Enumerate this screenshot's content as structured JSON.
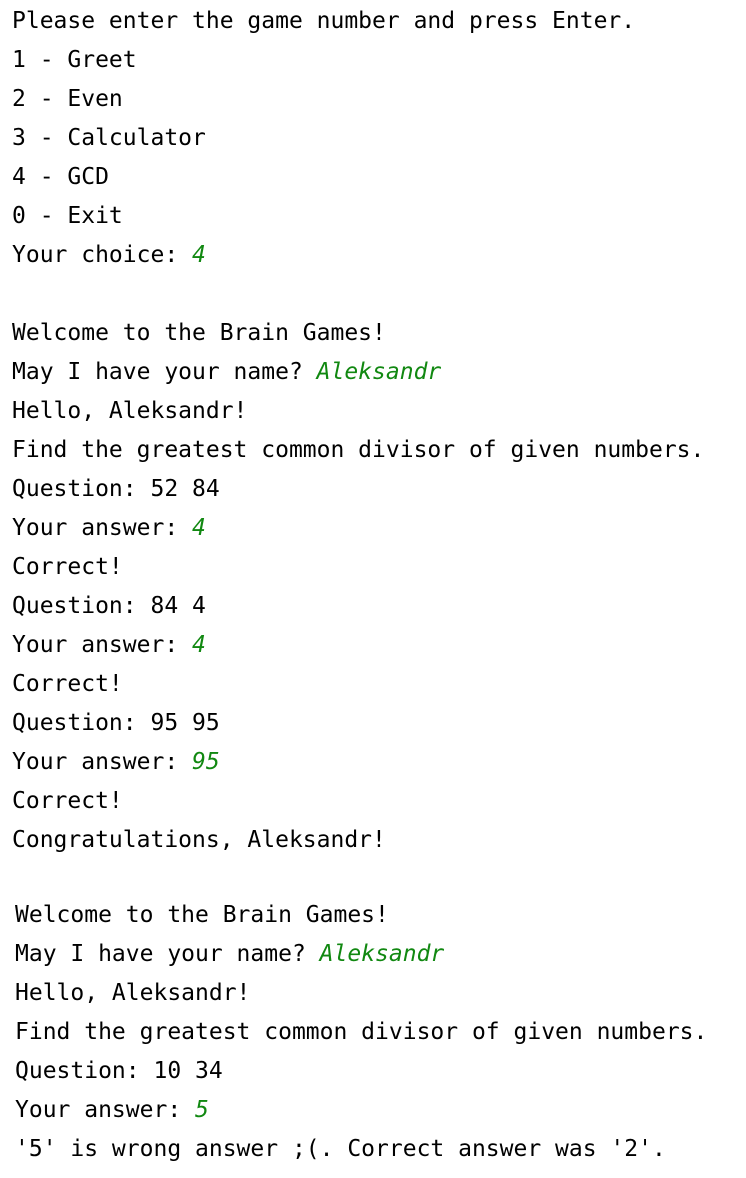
{
  "menu": {
    "prompt": "Please enter the game number and press Enter.",
    "options": [
      "1 - Greet",
      "2 - Even",
      "3 - Calculator",
      "4 - GCD",
      "0 - Exit"
    ],
    "choice_label": "Your choice: ",
    "choice_value": "4"
  },
  "session1": {
    "welcome": "Welcome to the Brain Games!",
    "name_prompt": "May I have your name? ",
    "name_value": "Aleksandr",
    "hello": "Hello, Aleksandr!",
    "rules": "Find the greatest common divisor of given numbers.",
    "rounds": [
      {
        "question": "Question: 52 84",
        "answer_label": "Your answer: ",
        "answer": "4",
        "result": "Correct!"
      },
      {
        "question": "Question: 84 4",
        "answer_label": "Your answer: ",
        "answer": "4",
        "result": "Correct!"
      },
      {
        "question": "Question: 95 95",
        "answer_label": "Your answer: ",
        "answer": "95",
        "result": "Correct!"
      }
    ],
    "final": "Congratulations, Aleksandr!"
  },
  "session2": {
    "welcome": "Welcome to the Brain Games!",
    "name_prompt": "May I have your name? ",
    "name_value": "Aleksandr",
    "hello": "Hello, Aleksandr!",
    "rules": "Find the greatest common divisor of given numbers.",
    "question": "Question: 10 34",
    "answer_label": "Your answer: ",
    "answer": "5",
    "result": "'5' is wrong answer ;(. Correct answer was '2'."
  },
  "colors": {
    "user_input": "#118811",
    "text": "#000000",
    "background": "#ffffff"
  }
}
